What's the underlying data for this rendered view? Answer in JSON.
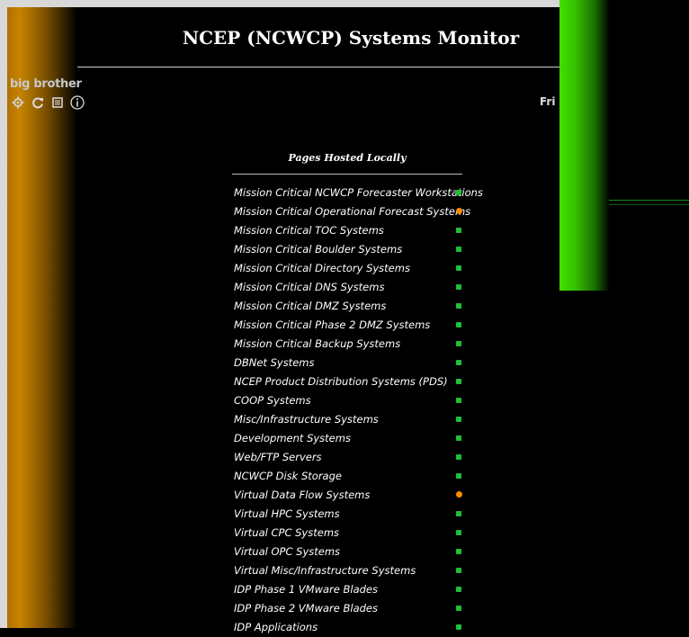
{
  "header": {
    "title": "NCEP (NCWCP) Systems Monitor",
    "brand_label": "big brother",
    "date_label": "Fri"
  },
  "toolbar": {
    "icons": [
      "gear-icon",
      "refresh-icon",
      "report-icon",
      "info-icon"
    ]
  },
  "section": {
    "title": "Pages Hosted Locally"
  },
  "items": [
    {
      "label": "Mission Critical NCWCP Forecaster Workstations",
      "status": "green"
    },
    {
      "label": "Mission Critical Operational Forecast Systems",
      "status": "orange"
    },
    {
      "label": "Mission Critical TOC Systems",
      "status": "green"
    },
    {
      "label": "Mission Critical Boulder Systems",
      "status": "green"
    },
    {
      "label": "Mission Critical Directory Systems",
      "status": "green"
    },
    {
      "label": "Mission Critical DNS Systems",
      "status": "green"
    },
    {
      "label": "Mission Critical DMZ Systems",
      "status": "green"
    },
    {
      "label": "Mission Critical Phase 2 DMZ Systems",
      "status": "green"
    },
    {
      "label": "Mission Critical Backup Systems",
      "status": "green"
    },
    {
      "label": "DBNet Systems",
      "status": "green"
    },
    {
      "label": "NCEP Product Distribution Systems (PDS)",
      "status": "green"
    },
    {
      "label": "COOP Systems",
      "status": "green"
    },
    {
      "label": "Misc/Infrastructure Systems",
      "status": "green"
    },
    {
      "label": "Development Systems",
      "status": "green"
    },
    {
      "label": "Web/FTP Servers",
      "status": "green"
    },
    {
      "label": "NCWCP Disk Storage",
      "status": "green"
    },
    {
      "label": "Virtual Data Flow Systems",
      "status": "orange"
    },
    {
      "label": "Virtual HPC Systems",
      "status": "green"
    },
    {
      "label": "Virtual CPC Systems",
      "status": "green"
    },
    {
      "label": "Virtual OPC Systems",
      "status": "green"
    },
    {
      "label": "Virtual Misc/Infrastructure Systems",
      "status": "green"
    },
    {
      "label": "IDP Phase 1 VMware Blades",
      "status": "green"
    },
    {
      "label": "IDP Phase 2 VMware Blades",
      "status": "green"
    },
    {
      "label": "IDP Applications",
      "status": "green"
    }
  ],
  "colors": {
    "status_green": "#1fbf3a",
    "status_orange": "#ff8a00"
  }
}
